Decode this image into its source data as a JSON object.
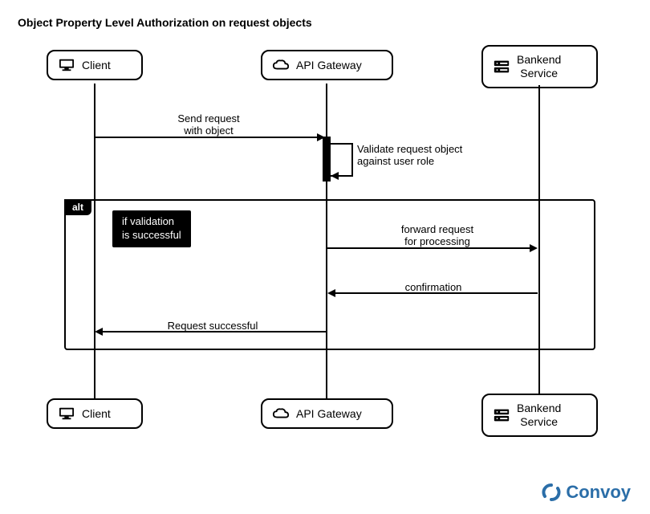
{
  "title": "Object Property Level Authorization on request objects",
  "participants": {
    "client": {
      "label": "Client"
    },
    "gateway": {
      "label": "API Gateway"
    },
    "backend": {
      "label": "Bankend\nService"
    }
  },
  "messages": {
    "m1": {
      "text": "Send request\nwith object"
    },
    "m2": {
      "text": "Validate request object\nagainst user role"
    },
    "m3": {
      "text": "forward request\nfor processing"
    },
    "m4": {
      "text": "confirmation"
    },
    "m5": {
      "text": "Request successful"
    }
  },
  "alt": {
    "tag": "alt",
    "condition": "if validation\nis successful"
  },
  "brand": {
    "name": "Convoy"
  }
}
